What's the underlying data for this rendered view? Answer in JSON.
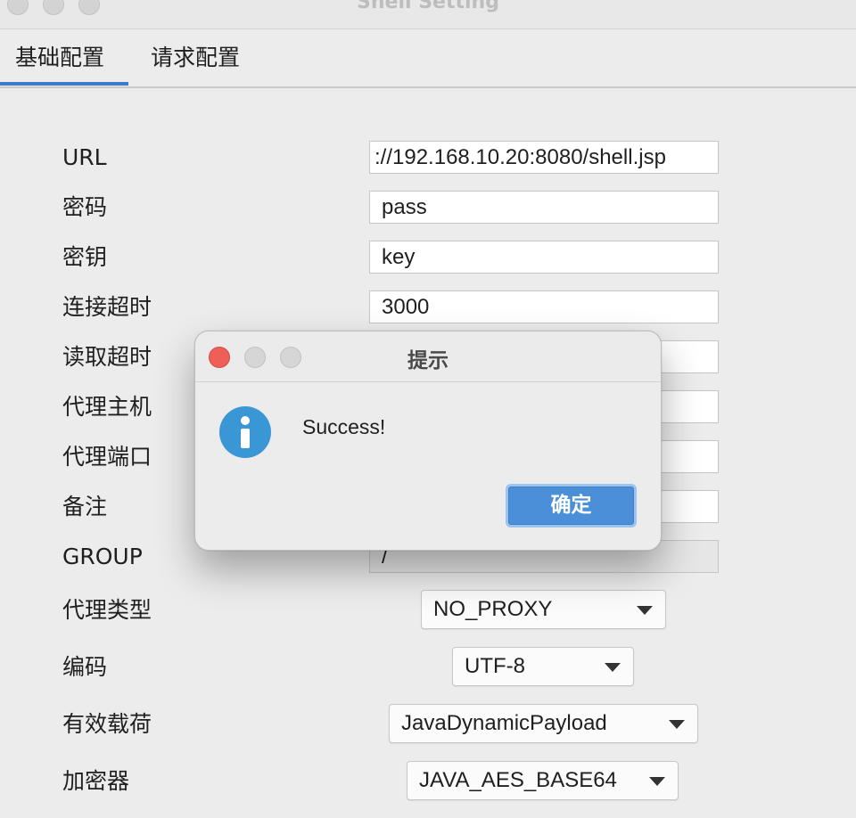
{
  "window": {
    "title": "Shell Setting"
  },
  "tabs": [
    {
      "label": "基础配置",
      "active": true
    },
    {
      "label": "请求配置",
      "active": false
    }
  ],
  "form": {
    "url": {
      "label": "URL",
      "value": "://192.168.10.20:8080/shell.jsp"
    },
    "password": {
      "label": "密码",
      "value": "pass"
    },
    "key": {
      "label": "密钥",
      "value": "key"
    },
    "connect_timeout": {
      "label": "连接超时",
      "value": "3000"
    },
    "read_timeout": {
      "label": "读取超时",
      "value": ""
    },
    "proxy_host": {
      "label": "代理主机",
      "value": ""
    },
    "proxy_port": {
      "label": "代理端口",
      "value": ""
    },
    "remark": {
      "label": "备注",
      "value": ""
    },
    "group": {
      "label": "GROUP",
      "value": "/"
    },
    "proxy_type": {
      "label": "代理类型",
      "value": "NO_PROXY"
    },
    "encoding": {
      "label": "编码",
      "value": "UTF-8"
    },
    "payload": {
      "label": "有效载荷",
      "value": "JavaDynamicPayload"
    },
    "cryption": {
      "label": "加密器",
      "value": "JAVA_AES_BASE64"
    }
  },
  "dialog": {
    "title": "提示",
    "message": "Success!",
    "ok_label": "确定",
    "icon": "info-icon"
  },
  "colors": {
    "accent": "#3d7cc9",
    "button_blue": "#4a8fd8",
    "info_blue": "#3a97d6",
    "close_red": "#ee5f58"
  }
}
